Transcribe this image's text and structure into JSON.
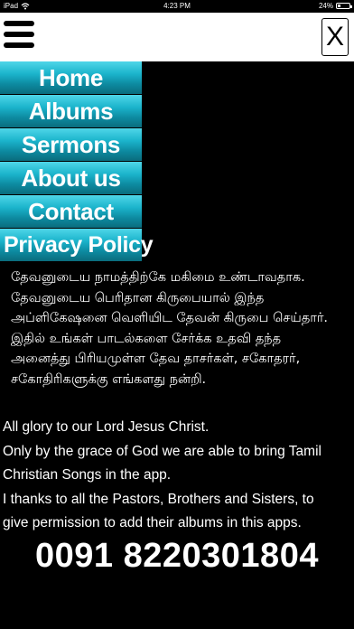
{
  "status_bar": {
    "carrier": "iPad",
    "time": "4:23 PM",
    "battery": "24%"
  },
  "header": {
    "close_label": "X"
  },
  "menu": {
    "items": [
      {
        "label": "Home"
      },
      {
        "label": "Albums"
      },
      {
        "label": "Sermons"
      },
      {
        "label": "About us"
      },
      {
        "label": "Contact"
      },
      {
        "label": "Privacy Policy"
      }
    ]
  },
  "content": {
    "tamil_lines": [
      "தேவனுடைய நாமத்திற்கே மகிமை உண்டாவதாக.",
      "தேவனுடைய பெரிதான கிருபையால் இந்த",
      "அப்ளிகேஷனை வெளியிட தேவன் கிருபை செய்தார்.",
      "இதில் உங்கள் பாடல்களை சேர்க்க உதவி தந்த",
      "அனைத்து பிரியமுள்ள தேவ தாசர்கள், சகோதரர்,",
      "சகோதிரிகளுக்கு எங்களது நன்றி."
    ],
    "english_lines": [
      "All glory to our Lord Jesus Christ.",
      "Only by the grace of God we are able to bring Tamil",
      "Christian Songs in the app.",
      "I thanks to all the Pastors, Brothers and Sisters, to",
      "give permission to add their albums in this apps."
    ],
    "phone": "0091 8220301804"
  }
}
